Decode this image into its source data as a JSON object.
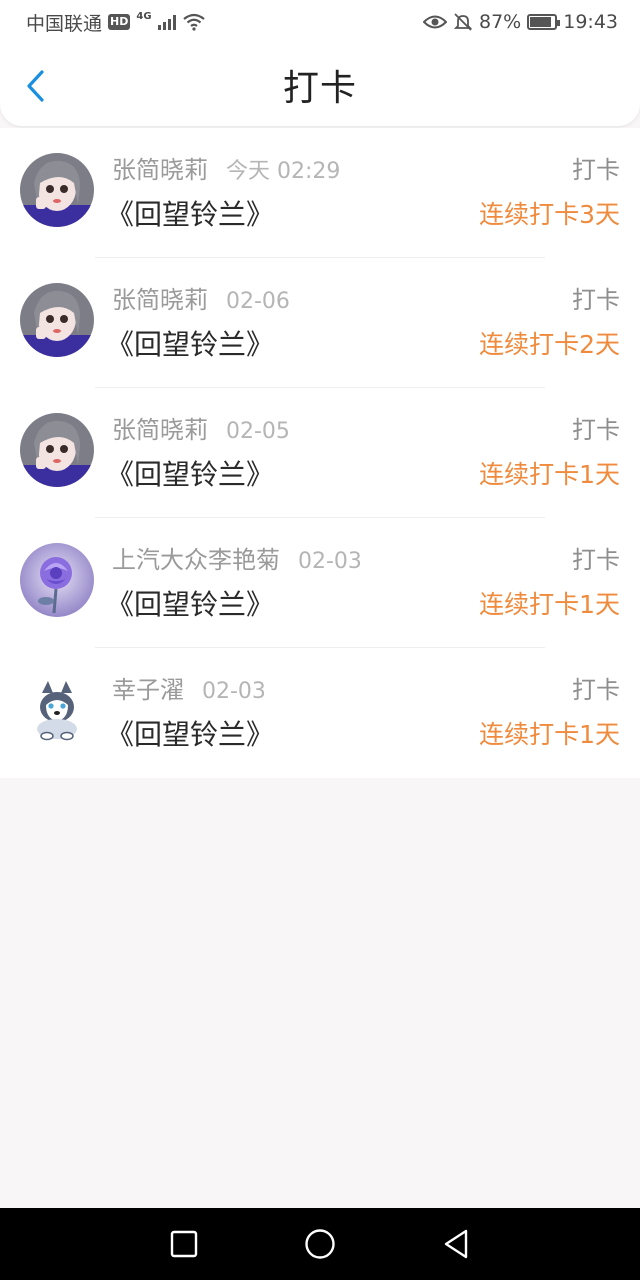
{
  "status_bar": {
    "carrier": "中国联通",
    "hd": "HD",
    "network": "4G",
    "battery_percent": "87%",
    "battery_level": 0.87,
    "time": "19:43"
  },
  "header": {
    "title": "打卡",
    "back_icon": "chevron-left-icon",
    "accent_color": "#1a8fe0"
  },
  "checkins": [
    {
      "name": "张简晓莉",
      "time": "今天 02:29",
      "action": "打卡",
      "book": "《回望铃兰》",
      "streak": "连续打卡3天",
      "avatar": "anime-girl"
    },
    {
      "name": "张简晓莉",
      "time": "02-06",
      "action": "打卡",
      "book": "《回望铃兰》",
      "streak": "连续打卡2天",
      "avatar": "anime-girl"
    },
    {
      "name": "张简晓莉",
      "time": "02-05",
      "action": "打卡",
      "book": "《回望铃兰》",
      "streak": "连续打卡1天",
      "avatar": "anime-girl"
    },
    {
      "name": "上汽大众李艳菊",
      "time": "02-03",
      "action": "打卡",
      "book": "《回望铃兰》",
      "streak": "连续打卡1天",
      "avatar": "purple-rose"
    },
    {
      "name": "幸子濯",
      "time": "02-03",
      "action": "打卡",
      "book": "《回望铃兰》",
      "streak": "连续打卡1天",
      "avatar": "husky-dog"
    }
  ],
  "colors": {
    "streak": "#f08a3c",
    "background": "#f8f6f7"
  },
  "nav": {
    "recent_icon": "square-icon",
    "home_icon": "circle-icon",
    "back_icon": "triangle-back-icon"
  }
}
